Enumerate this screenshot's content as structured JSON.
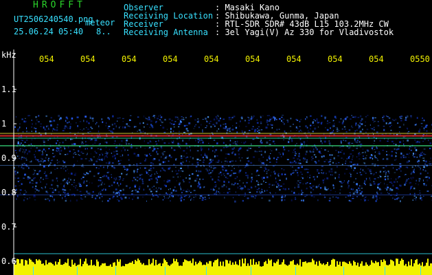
{
  "app": {
    "title": "HROFFT",
    "filename": "UT2506240540.png",
    "type_label": "meteor",
    "datetime": "25.06.24 05:40",
    "count": "8.."
  },
  "info": {
    "observer_label": "Observer",
    "observer_value": ": Masaki Kano",
    "location_label": "Receiving Location",
    "location_value": ": Shibukawa, Gunma, Japan",
    "receiver_label": "Receiver",
    "receiver_value": ": RTL-SDR SDR# 43dB L15 103.2MHz CW",
    "antenna_label": "Receiving Antenna",
    "antenna_value": ": 3el Yagi(V) Az 330 for Vladivostok"
  },
  "axes": {
    "y_unit": "kHz",
    "y_ticks": [
      "1.1",
      "1",
      "0.9",
      "0.8",
      "0.7",
      "0.6"
    ],
    "x_ticks": [
      "054",
      "054",
      "054",
      "054",
      "054",
      "054",
      "054",
      "054",
      "054",
      "0550"
    ]
  },
  "colors": {
    "accent_green": "#2bd62b",
    "label_cyan": "#38e0ff",
    "tick_yellow": "#f2f200",
    "signal_red": "#ff3030",
    "background": "#000000"
  }
}
